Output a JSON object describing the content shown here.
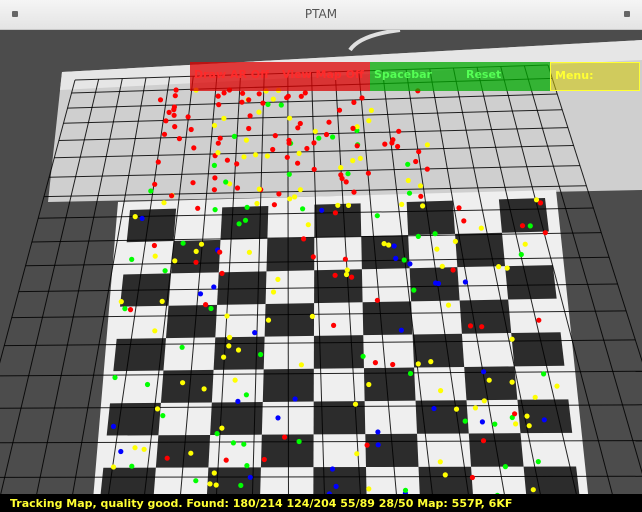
{
  "window": {
    "title": "PTAM"
  },
  "menu": {
    "items": [
      {
        "label": "Draw AR Off",
        "color": "red"
      },
      {
        "label": "View Map Off",
        "color": "red"
      },
      {
        "label": "Spacebar",
        "color": "green"
      },
      {
        "label": "Reset",
        "color": "green"
      },
      {
        "label": "Menu:",
        "color": "yellow"
      }
    ]
  },
  "status": {
    "text": "Tracking Map, quality good. Found: 180/214  124/204  55/89  28/50  Map: 557P, 6KF"
  },
  "colors": {
    "red": "#ff0000",
    "yellow": "#ffff00",
    "green": "#00ff00",
    "blue": "#0000ff",
    "grid": "#000000"
  },
  "icons": {
    "window_left": "window-menu-icon",
    "window_right": "window-close-icon"
  }
}
